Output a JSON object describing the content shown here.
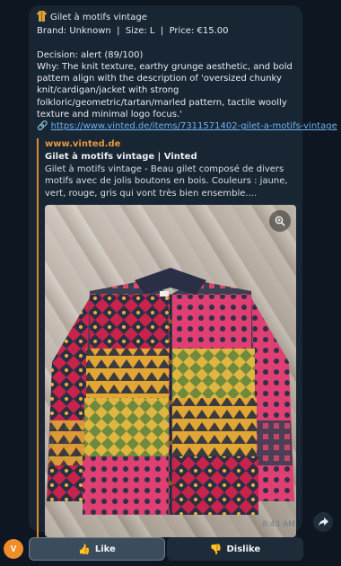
{
  "message": {
    "title_icon": "cardigan-icon",
    "title": "Gilet à motifs vintage",
    "brand_line": "Brand: Unknown  |  Size: L  |  Price: €15.00",
    "decision": "Decision: alert (89/100)",
    "why": "Why: The knit texture, earthy grunge aesthetic, and bold pattern align with the description of 'oversized chunky knit/cardigan/jacket with strong folkloric/geometric/tartan/marled pattern, tactile woolly texture and minimal logo focus.'",
    "link_icon": "🔗",
    "url": "https://www.vinted.de/items/7311571402-gilet-a-motifs-vintage",
    "time": "8:43 AM"
  },
  "preview": {
    "site": "www.vinted.de",
    "title": "Gilet à motifs vintage | Vinted",
    "description": "Gilet à motifs vintage - Beau gilet composé de divers motifs avec de jolis boutons en bois. Couleurs : jaune, vert, rouge, gris qui vont très bien ensemble...."
  },
  "buttons": {
    "like_emoji": "👍",
    "like_label": "Like",
    "dislike_emoji": "👎",
    "dislike_label": "Dislike"
  },
  "avatar": {
    "initial": "V",
    "color": "#f08c2a"
  },
  "colors": {
    "background": "#0e1621",
    "bubble": "#182533",
    "link": "#6ab3f3",
    "preview_accent": "#e08a2c"
  }
}
